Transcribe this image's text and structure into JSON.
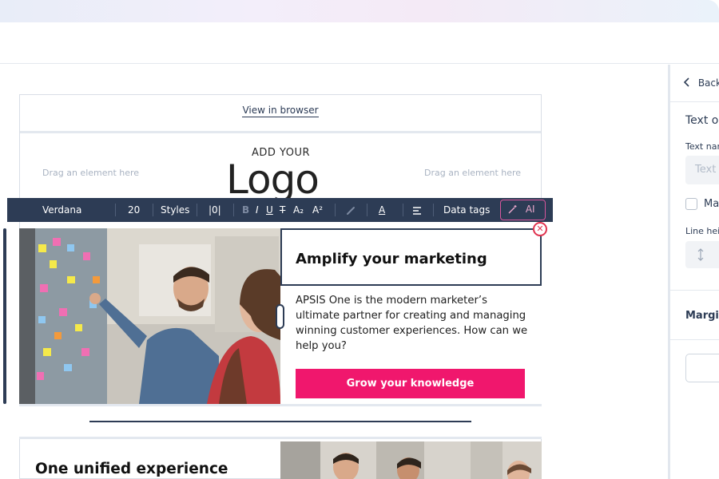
{
  "email": {
    "view_in_browser": "View in browser",
    "drag_left": "Drag an element here",
    "drag_right": "Drag an element here",
    "logo_small": "ADD YOUR",
    "logo_big": "Logo"
  },
  "toolbar": {
    "font": "Verdana",
    "size": "20",
    "styles": "Styles",
    "clear_format": "|0|",
    "bold": "B",
    "italic": "I",
    "underline": "U",
    "strike": "T",
    "subscript": "A₂",
    "superscript": "A²",
    "link_icon": "link-icon",
    "text_color": "A",
    "align_icon": "align-left-icon",
    "data_tags": "Data tags",
    "ai": "AI"
  },
  "hero": {
    "heading": "Amplify your marketing",
    "body": "APSIS One is the modern marketer’s ultimate partner for creating and managing winning customer experiences. How can we help you?",
    "cta": "Grow your knowledge"
  },
  "section2": {
    "heading": "One unified experience"
  },
  "panel": {
    "back": "Back",
    "section_title": "Text op",
    "text_name_label": "Text nar",
    "text_name_placeholder": "Text",
    "checkbox_label": "Ma",
    "line_height_label": "Line hei",
    "margin_label": "Margin"
  },
  "colors": {
    "toolbar_bg": "#2d3c55",
    "cta_bg": "#f0176d",
    "ai_accent": "#d7569c",
    "close_red": "#e0334f"
  }
}
